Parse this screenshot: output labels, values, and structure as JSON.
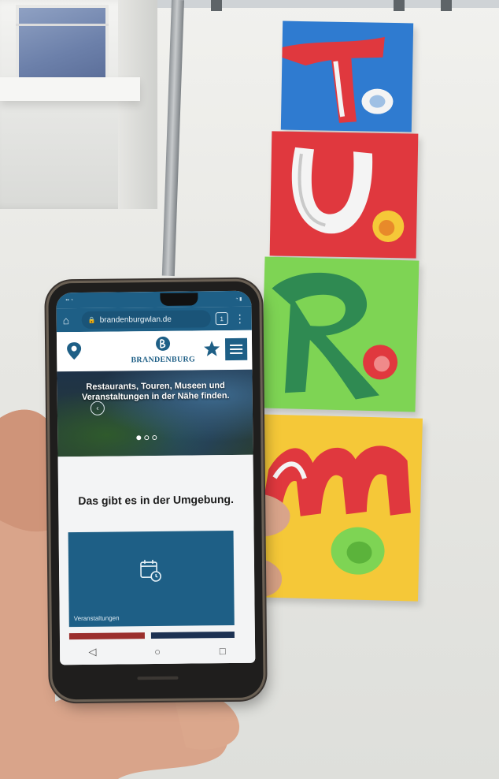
{
  "phone": {
    "url_bar": {
      "home_icon": "home-icon",
      "url": "brandenburgwlan.de",
      "tab_count": "1",
      "menu_icon": "more-vert-icon"
    },
    "header": {
      "location_icon": "location-pin-icon",
      "logo_text": "BRANDENBURG",
      "favorite_icon": "star-icon",
      "menu_icon": "hamburger-menu-icon"
    },
    "hero": {
      "text": "Restaurants, Touren, Museen und Veranstaltungen in der Nähe finden.",
      "prev_icon": "chevron-left-icon"
    },
    "section": {
      "title": "Das gibt es in der Umgebung.",
      "card_label": "Veranstaltungen",
      "card_icon": "calendar-clock-icon"
    },
    "navbar": {
      "back_icon": "back-triangle-icon",
      "home_icon": "home-circle-icon",
      "recents_icon": "recents-square-icon"
    }
  },
  "colors": {
    "brand_blue": "#1e5f86",
    "tile_blue": "#2f7bd0",
    "tile_red": "#e0383e",
    "tile_green": "#7ed454",
    "tile_yellow": "#f5c838"
  }
}
